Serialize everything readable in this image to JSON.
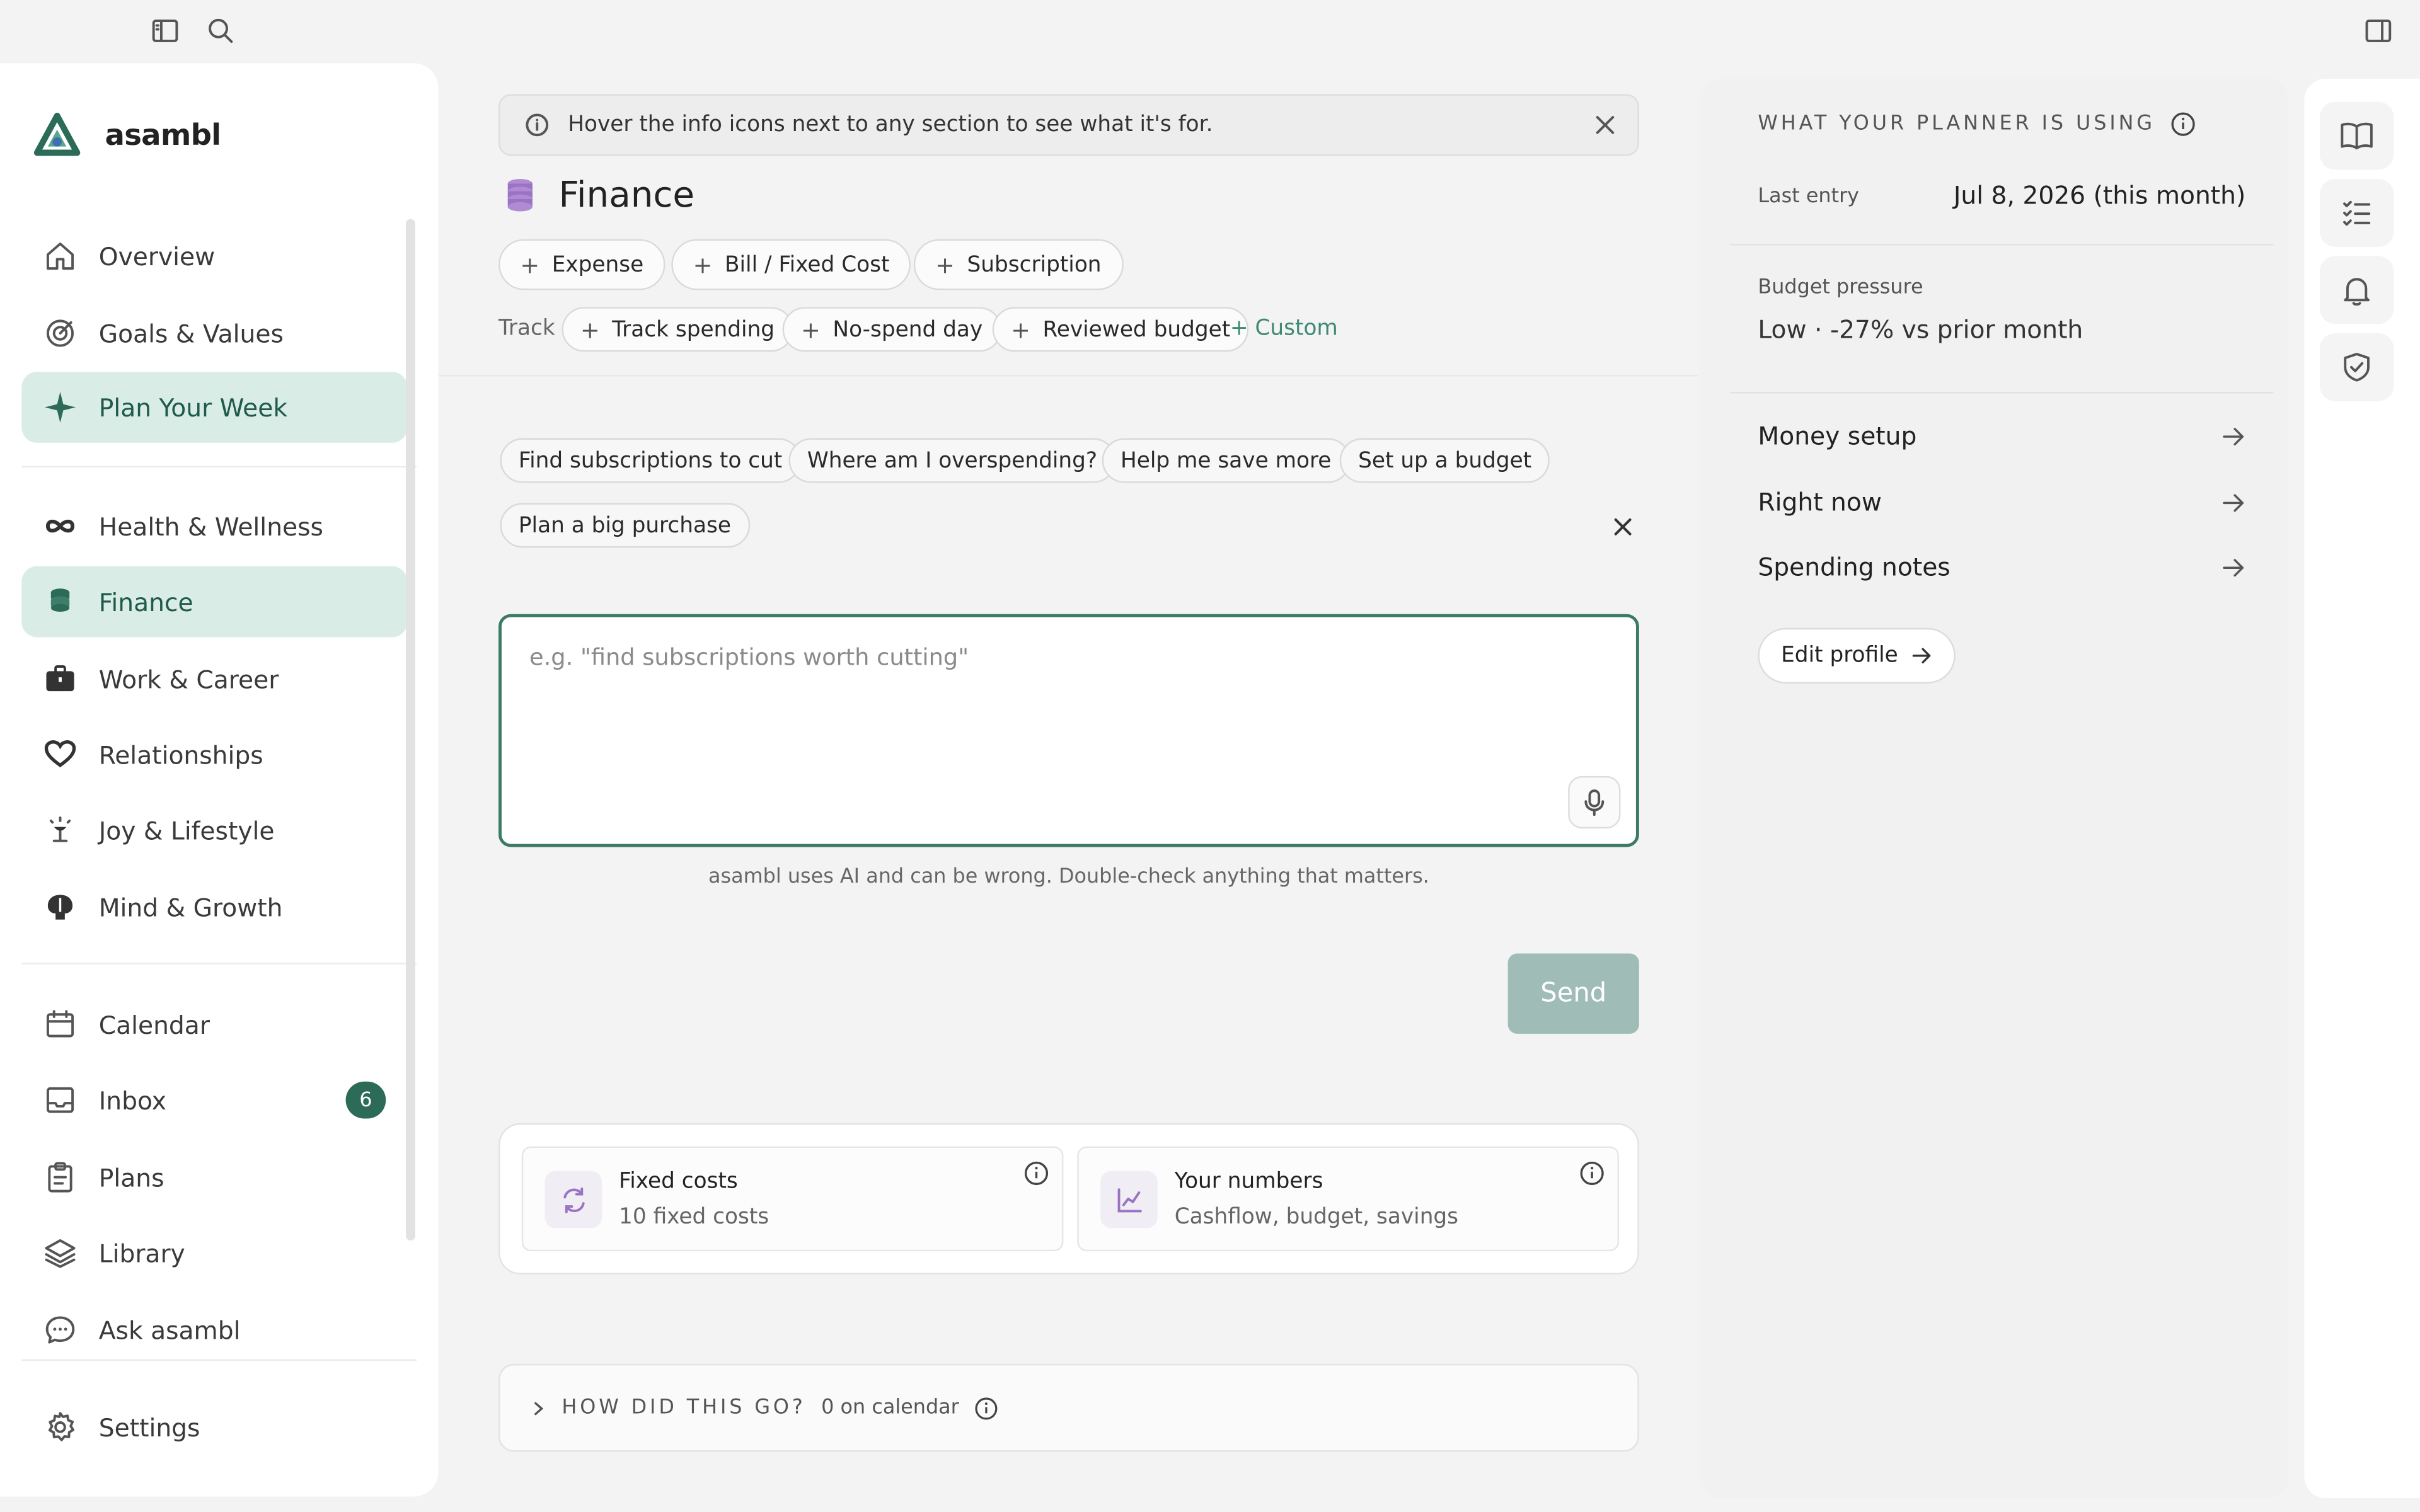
{
  "brand": {
    "name": "asambl",
    "accent": "#2c6b58"
  },
  "sidebar": {
    "items": [
      {
        "label": "Overview",
        "icon": "home-icon"
      },
      {
        "label": "Goals & Values",
        "icon": "target-icon"
      },
      {
        "label": "Plan Your Week",
        "icon": "sparkle-icon",
        "active": true
      },
      {
        "label": "Health & Wellness",
        "icon": "infinity-icon"
      },
      {
        "label": "Finance",
        "icon": "coins-icon",
        "active": true
      },
      {
        "label": "Work & Career",
        "icon": "briefcase-icon"
      },
      {
        "label": "Relationships",
        "icon": "heart-icon"
      },
      {
        "label": "Joy & Lifestyle",
        "icon": "lamp-icon"
      },
      {
        "label": "Mind & Growth",
        "icon": "brain-icon"
      },
      {
        "label": "Calendar",
        "icon": "calendar-icon"
      },
      {
        "label": "Inbox",
        "icon": "inbox-icon",
        "badge": "6"
      },
      {
        "label": "Plans",
        "icon": "clipboard-icon"
      },
      {
        "label": "Library",
        "icon": "layers-icon"
      },
      {
        "label": "Ask asambl",
        "icon": "chat-icon"
      },
      {
        "label": "Settings",
        "icon": "gear-icon"
      }
    ]
  },
  "main": {
    "banner": "Hover the info icons next to any section to see what it's for.",
    "title": "Finance",
    "add_buttons": [
      "Expense",
      "Bill / Fixed Cost",
      "Subscription"
    ],
    "track_label": "Track",
    "track_buttons": [
      "Track spending",
      "No-spend day",
      "Reviewed budget"
    ],
    "custom_label": "+ Custom",
    "suggestions": [
      "Find subscriptions to cut",
      "Where am I overspending?",
      "Help me save more",
      "Set up a budget",
      "Plan a big purchase"
    ],
    "input_placeholder": "e.g. \"find subscriptions worth cutting\"",
    "disclaimer": "asambl uses AI and can be wrong. Double-check anything that matters.",
    "send_label": "Send",
    "cards": [
      {
        "title": "Fixed costs",
        "subtitle": "10 fixed costs"
      },
      {
        "title": "Your numbers",
        "subtitle": "Cashflow, budget, savings"
      }
    ],
    "feedback": {
      "title": "HOW DID THIS GO?",
      "subtitle": "0 on calendar"
    }
  },
  "right_panel": {
    "heading": "WHAT YOUR PLANNER IS USING",
    "last_entry_label": "Last entry",
    "last_entry_value": "Jul 8, 2026 (this month)",
    "budget_label": "Budget pressure",
    "budget_value": "Low · -27% vs prior month",
    "links": [
      "Money setup",
      "Right now",
      "Spending notes"
    ],
    "edit_profile": "Edit profile"
  }
}
